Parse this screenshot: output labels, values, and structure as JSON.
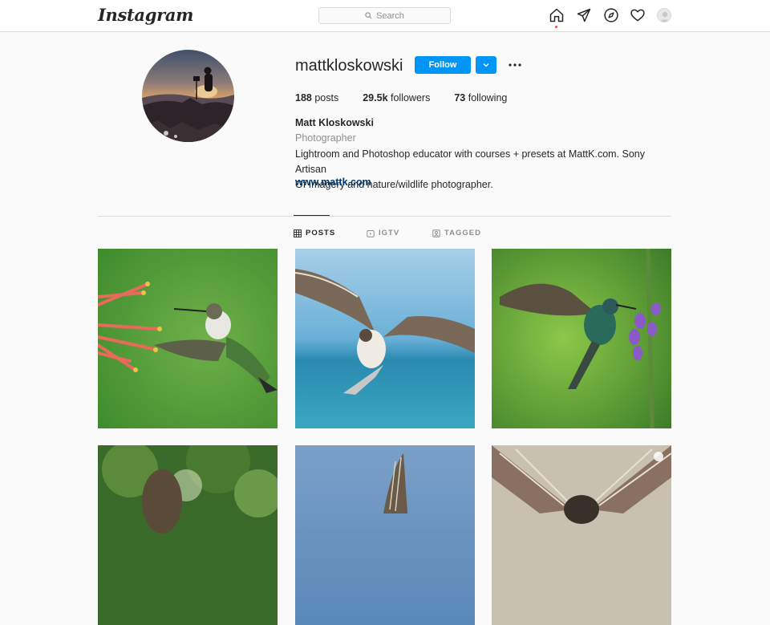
{
  "topbar": {
    "logo": "Instagram",
    "search_placeholder": "Search",
    "icons": [
      "home-icon",
      "direct-icon",
      "explore-icon",
      "heart-icon",
      "profile-avatar"
    ]
  },
  "profile": {
    "username": "mattkloskowski",
    "follow_label": "Follow",
    "posts_count": "188",
    "posts_label": "posts",
    "followers_count": "29.5k",
    "followers_label": "followers",
    "following_count": "73",
    "following_label": "following",
    "full_name": "Matt Kloskowski",
    "category": "Photographer",
    "bio_line1": "Lightroom and Photoshop educator with courses + presets at MattK.com. Sony Artisan",
    "bio_line2": "Of Imagery and nature/wildlife photographer.",
    "website": "www.mattk.com"
  },
  "tabs": [
    {
      "label": "POSTS",
      "icon": "grid-icon",
      "active": true
    },
    {
      "label": "IGTV",
      "icon": "igtv-icon",
      "active": false
    },
    {
      "label": "TAGGED",
      "icon": "tagged-icon",
      "active": false
    }
  ],
  "posts": [
    {
      "subject": "hummingbird-with-red-flowers"
    },
    {
      "subject": "osprey-with-fish-over-sea"
    },
    {
      "subject": "hummingbird-with-purple-flowers"
    },
    {
      "subject": "bird-in-tree"
    },
    {
      "subject": "bird-wing-over-water"
    },
    {
      "subject": "osprey-wings-spread"
    }
  ],
  "colors": {
    "accent": "#0095f6",
    "link": "#00376b",
    "notification_dot": "#ed4956"
  }
}
